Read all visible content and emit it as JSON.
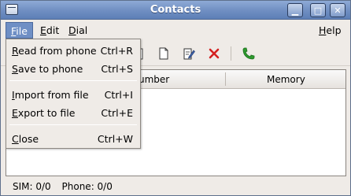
{
  "window": {
    "title": "Contacts",
    "buttons": {
      "minimize": "▁",
      "maximize": "□",
      "close": "✕"
    }
  },
  "menubar": {
    "items": [
      {
        "mnemonic": "F",
        "rest": "ile"
      },
      {
        "mnemonic": "E",
        "rest": "dit"
      },
      {
        "mnemonic": "D",
        "rest": "ial"
      },
      {
        "mnemonic": "H",
        "rest": "elp"
      }
    ]
  },
  "file_menu": {
    "items": [
      {
        "mnemonic": "R",
        "rest": "ead from phone",
        "accel": "Ctrl+R"
      },
      {
        "mnemonic": "S",
        "rest": "ave to phone",
        "accel": "Ctrl+S"
      },
      {
        "mnemonic": "I",
        "rest": "mport from file",
        "accel": "Ctrl+I"
      },
      {
        "mnemonic": "E",
        "rest": "xport to file",
        "accel": "Ctrl+E"
      },
      {
        "mnemonic": "C",
        "rest": "lose",
        "accel": "Ctrl+W"
      }
    ]
  },
  "toolbar": {
    "icons": [
      "paste-icon",
      "new-document-icon",
      "edit-icon",
      "delete-icon",
      "call-icon"
    ]
  },
  "list": {
    "columns": [
      "umber",
      "Memory"
    ]
  },
  "status": {
    "sim": "SIM: 0/0",
    "phone": "Phone: 0/0"
  },
  "colors": {
    "titlebar": "#6f8ec2",
    "menu_highlight": "#6f8fc5",
    "delete_red": "#d42020",
    "call_green": "#2e9a2e"
  }
}
